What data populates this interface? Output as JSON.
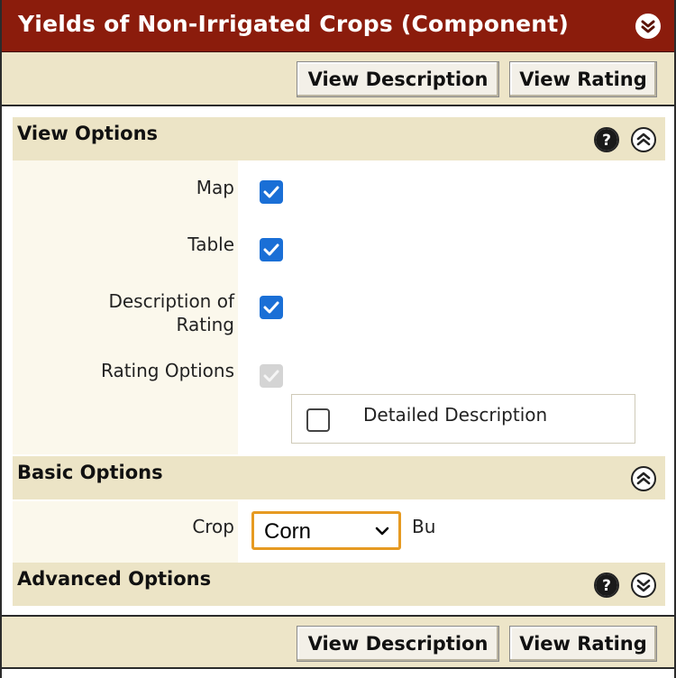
{
  "title": "Yields of Non-Irrigated Crops (Component)",
  "toolbar": {
    "view_description": "View Description",
    "view_rating": "View Rating"
  },
  "view_options": {
    "title": "View Options",
    "rows": [
      {
        "label": "Map",
        "checked": true,
        "disabled": false
      },
      {
        "label": "Table",
        "checked": true,
        "disabled": false
      },
      {
        "label_line1": "Description of",
        "label_line2": "Rating",
        "checked": true,
        "disabled": false
      },
      {
        "label": "Rating Options",
        "checked": true,
        "disabled": true
      }
    ],
    "rating_options": {
      "detailed_description_label": "Detailed Description",
      "detailed_description_checked": false
    }
  },
  "basic_options": {
    "title": "Basic Options",
    "crop_label": "Crop",
    "crop_value": "Corn",
    "crop_unit": "Bu"
  },
  "advanced_options": {
    "title": "Advanced Options"
  },
  "colors": {
    "title_bar": "#8b1c0c",
    "section_bg": "#ece4c6",
    "checkbox_checked": "#1a6fd6",
    "select_focus": "#e69a22"
  },
  "icons": {
    "collapse_panel": "chevron-down-circle-icon",
    "help": "question-circle-icon",
    "collapse_section": "chevron-up-circle-icon",
    "expand_section": "chevron-down-circle-icon"
  }
}
